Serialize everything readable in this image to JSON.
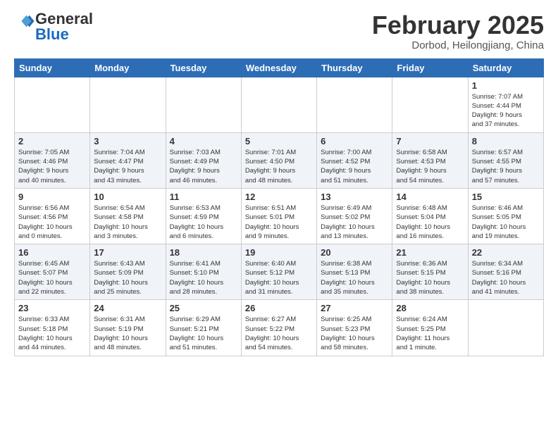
{
  "logo": {
    "general": "General",
    "blue": "Blue"
  },
  "title": "February 2025",
  "location": "Dorbod, Heilongjiang, China",
  "headers": [
    "Sunday",
    "Monday",
    "Tuesday",
    "Wednesday",
    "Thursday",
    "Friday",
    "Saturday"
  ],
  "weeks": [
    [
      {
        "day": "",
        "info": ""
      },
      {
        "day": "",
        "info": ""
      },
      {
        "day": "",
        "info": ""
      },
      {
        "day": "",
        "info": ""
      },
      {
        "day": "",
        "info": ""
      },
      {
        "day": "",
        "info": ""
      },
      {
        "day": "1",
        "info": "Sunrise: 7:07 AM\nSunset: 4:44 PM\nDaylight: 9 hours\nand 37 minutes."
      }
    ],
    [
      {
        "day": "2",
        "info": "Sunrise: 7:05 AM\nSunset: 4:46 PM\nDaylight: 9 hours\nand 40 minutes."
      },
      {
        "day": "3",
        "info": "Sunrise: 7:04 AM\nSunset: 4:47 PM\nDaylight: 9 hours\nand 43 minutes."
      },
      {
        "day": "4",
        "info": "Sunrise: 7:03 AM\nSunset: 4:49 PM\nDaylight: 9 hours\nand 46 minutes."
      },
      {
        "day": "5",
        "info": "Sunrise: 7:01 AM\nSunset: 4:50 PM\nDaylight: 9 hours\nand 48 minutes."
      },
      {
        "day": "6",
        "info": "Sunrise: 7:00 AM\nSunset: 4:52 PM\nDaylight: 9 hours\nand 51 minutes."
      },
      {
        "day": "7",
        "info": "Sunrise: 6:58 AM\nSunset: 4:53 PM\nDaylight: 9 hours\nand 54 minutes."
      },
      {
        "day": "8",
        "info": "Sunrise: 6:57 AM\nSunset: 4:55 PM\nDaylight: 9 hours\nand 57 minutes."
      }
    ],
    [
      {
        "day": "9",
        "info": "Sunrise: 6:56 AM\nSunset: 4:56 PM\nDaylight: 10 hours\nand 0 minutes."
      },
      {
        "day": "10",
        "info": "Sunrise: 6:54 AM\nSunset: 4:58 PM\nDaylight: 10 hours\nand 3 minutes."
      },
      {
        "day": "11",
        "info": "Sunrise: 6:53 AM\nSunset: 4:59 PM\nDaylight: 10 hours\nand 6 minutes."
      },
      {
        "day": "12",
        "info": "Sunrise: 6:51 AM\nSunset: 5:01 PM\nDaylight: 10 hours\nand 9 minutes."
      },
      {
        "day": "13",
        "info": "Sunrise: 6:49 AM\nSunset: 5:02 PM\nDaylight: 10 hours\nand 13 minutes."
      },
      {
        "day": "14",
        "info": "Sunrise: 6:48 AM\nSunset: 5:04 PM\nDaylight: 10 hours\nand 16 minutes."
      },
      {
        "day": "15",
        "info": "Sunrise: 6:46 AM\nSunset: 5:05 PM\nDaylight: 10 hours\nand 19 minutes."
      }
    ],
    [
      {
        "day": "16",
        "info": "Sunrise: 6:45 AM\nSunset: 5:07 PM\nDaylight: 10 hours\nand 22 minutes."
      },
      {
        "day": "17",
        "info": "Sunrise: 6:43 AM\nSunset: 5:09 PM\nDaylight: 10 hours\nand 25 minutes."
      },
      {
        "day": "18",
        "info": "Sunrise: 6:41 AM\nSunset: 5:10 PM\nDaylight: 10 hours\nand 28 minutes."
      },
      {
        "day": "19",
        "info": "Sunrise: 6:40 AM\nSunset: 5:12 PM\nDaylight: 10 hours\nand 31 minutes."
      },
      {
        "day": "20",
        "info": "Sunrise: 6:38 AM\nSunset: 5:13 PM\nDaylight: 10 hours\nand 35 minutes."
      },
      {
        "day": "21",
        "info": "Sunrise: 6:36 AM\nSunset: 5:15 PM\nDaylight: 10 hours\nand 38 minutes."
      },
      {
        "day": "22",
        "info": "Sunrise: 6:34 AM\nSunset: 5:16 PM\nDaylight: 10 hours\nand 41 minutes."
      }
    ],
    [
      {
        "day": "23",
        "info": "Sunrise: 6:33 AM\nSunset: 5:18 PM\nDaylight: 10 hours\nand 44 minutes."
      },
      {
        "day": "24",
        "info": "Sunrise: 6:31 AM\nSunset: 5:19 PM\nDaylight: 10 hours\nand 48 minutes."
      },
      {
        "day": "25",
        "info": "Sunrise: 6:29 AM\nSunset: 5:21 PM\nDaylight: 10 hours\nand 51 minutes."
      },
      {
        "day": "26",
        "info": "Sunrise: 6:27 AM\nSunset: 5:22 PM\nDaylight: 10 hours\nand 54 minutes."
      },
      {
        "day": "27",
        "info": "Sunrise: 6:25 AM\nSunset: 5:23 PM\nDaylight: 10 hours\nand 58 minutes."
      },
      {
        "day": "28",
        "info": "Sunrise: 6:24 AM\nSunset: 5:25 PM\nDaylight: 11 hours\nand 1 minute."
      },
      {
        "day": "",
        "info": ""
      }
    ]
  ]
}
